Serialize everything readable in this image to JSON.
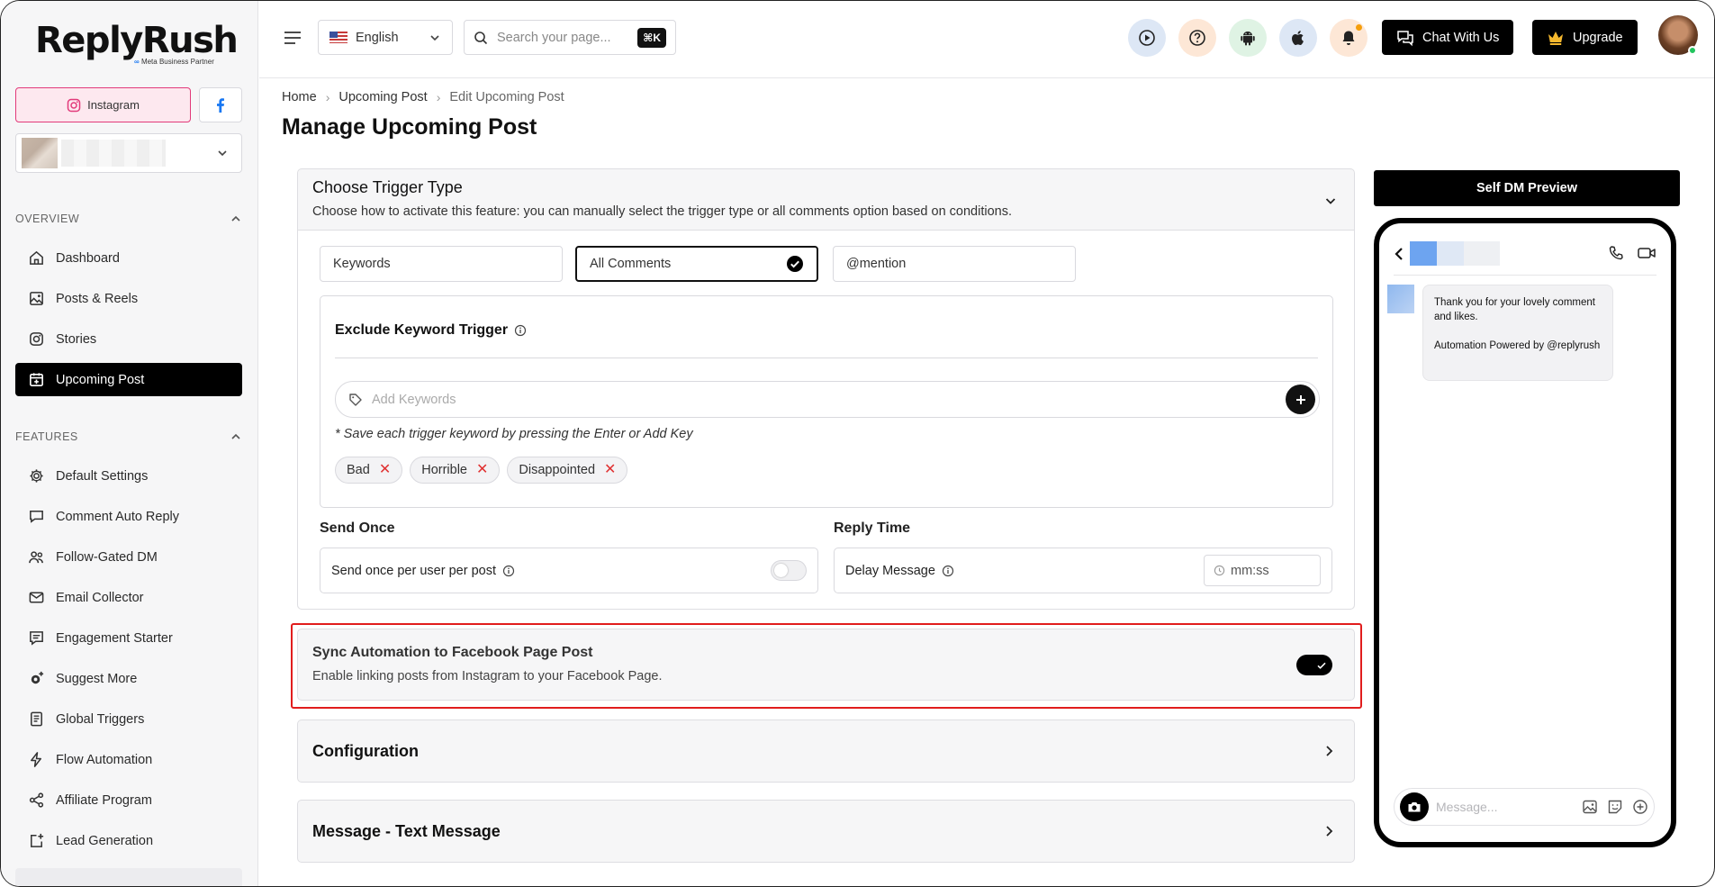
{
  "brand": {
    "name": "ReplyRush",
    "partner": "Meta Business Partner"
  },
  "sidebar": {
    "instagram_label": "Instagram",
    "overview_label": "OVERVIEW",
    "features_label": "FEATURES",
    "overview_items": [
      {
        "label": "Dashboard",
        "icon": "home-icon"
      },
      {
        "label": "Posts & Reels",
        "icon": "image-icon"
      },
      {
        "label": "Stories",
        "icon": "instagram-icon"
      },
      {
        "label": "Upcoming Post",
        "icon": "calendar-icon",
        "active": true
      }
    ],
    "feature_items": [
      {
        "label": "Default Settings",
        "icon": "gear-icon"
      },
      {
        "label": "Comment Auto Reply",
        "icon": "comment-icon"
      },
      {
        "label": "Follow-Gated DM",
        "icon": "users-icon"
      },
      {
        "label": "Email Collector",
        "icon": "mail-icon"
      },
      {
        "label": "Engagement Starter",
        "icon": "chat-list-icon"
      },
      {
        "label": "Suggest More",
        "icon": "gear-plus-icon"
      },
      {
        "label": "Global Triggers",
        "icon": "book-icon"
      },
      {
        "label": "Flow Automation",
        "icon": "lightning-icon"
      },
      {
        "label": "Affiliate Program",
        "icon": "share-icon"
      },
      {
        "label": "Lead Generation",
        "icon": "lead-icon"
      }
    ]
  },
  "topbar": {
    "language": "English",
    "search_placeholder": "Search your page...",
    "search_shortcut": "⌘K",
    "chat_label": "Chat With Us",
    "upgrade_label": "Upgrade"
  },
  "breadcrumb": [
    "Home",
    "Upcoming Post",
    "Edit Upcoming Post"
  ],
  "page_title": "Manage Upcoming Post",
  "trigger": {
    "title": "Choose Trigger Type",
    "description": "Choose how to activate this feature: you can manually select the trigger type or all comments option based on conditions.",
    "options": [
      "Keywords",
      "All Comments",
      "@mention"
    ],
    "selected": "All Comments",
    "exclude_title": "Exclude Keyword Trigger",
    "keyword_placeholder": "Add Keywords",
    "keyword_hint": "* Save each trigger keyword by pressing the Enter or Add Key",
    "keywords": [
      "Bad",
      "Horrible",
      "Disappointed"
    ],
    "send_once_title": "Send Once",
    "send_once_label": "Send once per user per post",
    "send_once_enabled": false,
    "reply_time_title": "Reply Time",
    "delay_label": "Delay Message",
    "delay_placeholder": "mm:ss"
  },
  "sync": {
    "title": "Sync Automation to Facebook Page Post",
    "description": "Enable linking posts from Instagram to your Facebook Page.",
    "enabled": true
  },
  "sections": [
    "Configuration",
    "Message - Text Message"
  ],
  "preview": {
    "button_label": "Self DM Preview",
    "message_line1": "Thank you for your lovely comment and likes.",
    "message_line2": "Automation Powered by @replyrush",
    "input_placeholder": "Message..."
  },
  "colors": {
    "accent": "#000000",
    "instagram_pink": "#e23a7a",
    "facebook_blue": "#1877f2",
    "highlight_red": "#e11d1d"
  }
}
